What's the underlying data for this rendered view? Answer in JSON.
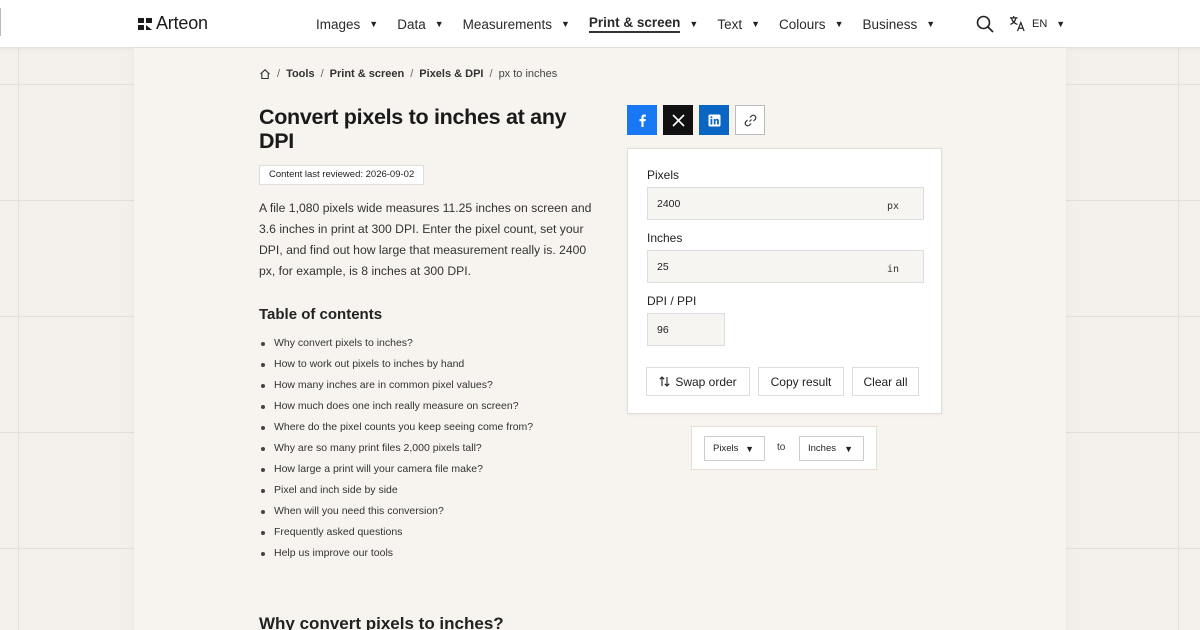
{
  "brand": {
    "name": "Arteon"
  },
  "nav": {
    "items": [
      {
        "label": "Images",
        "active": false
      },
      {
        "label": "Data",
        "active": false
      },
      {
        "label": "Measurements",
        "active": false
      },
      {
        "label": "Print & screen",
        "active": true
      },
      {
        "label": "Text",
        "active": false
      },
      {
        "label": "Colours",
        "active": false
      },
      {
        "label": "Business",
        "active": false
      }
    ],
    "caret": "▼",
    "language": "EN"
  },
  "breadcrumb": {
    "items": [
      "Tools",
      "Print & screen",
      "Pixels & DPI"
    ],
    "current": "px to inches",
    "separator": "/"
  },
  "page": {
    "title": "Convert pixels to inches at any DPI",
    "reviewed": "Content last reviewed: 2026-09-02",
    "intro": "A file 1,080 pixels wide measures 11.25 inches on screen and 3.6 inches in print at 300 DPI. Enter the pixel count, set your DPI, and find out how large that measurement really is. 2400 px, for example, is 8 inches at 300 DPI."
  },
  "toc": {
    "title": "Table of contents",
    "items": [
      "Why convert pixels to inches?",
      "How to work out pixels to inches by hand",
      "How many inches are in common pixel values?",
      "How much does one inch really measure on screen?",
      "Where do the pixel counts you keep seeing come from?",
      "Why are so many print files 2,000 pixels tall?",
      "How large a print will your camera file make?",
      "Pixel and inch side by side",
      "When will you need this conversion?",
      "Frequently asked questions",
      "Help us improve our tools"
    ]
  },
  "section": {
    "heading": "Why convert pixels to inches?"
  },
  "share": {
    "facebook": "facebook-icon",
    "x": "x-icon",
    "linkedin": "linkedin-icon",
    "link": "link-icon"
  },
  "converter": {
    "pixels": {
      "label": "Pixels",
      "value": "2400",
      "unit": "px"
    },
    "inches": {
      "label": "Inches",
      "value": "25",
      "unit": "in"
    },
    "dpi": {
      "label": "DPI / PPI",
      "value": "96"
    },
    "buttons": {
      "swap": "Swap order",
      "copy": "Copy result",
      "clear": "Clear all"
    }
  },
  "unit_selector": {
    "from": "Pixels",
    "to_label": "to",
    "to": "Inches"
  },
  "colors": {
    "facebook": "#1877f2",
    "x": "#111111",
    "linkedin": "#0a66c2",
    "background": "#f3efea",
    "panel": "#f7f4f0"
  }
}
